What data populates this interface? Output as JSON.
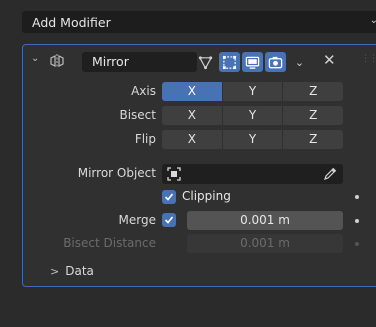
{
  "add_modifier": {
    "label": "Add Modifier",
    "chevron": "chevron-down-icon"
  },
  "modifier": {
    "name": "Mirror",
    "icons": {
      "collapse": "chevron-down-icon",
      "modifier_type": "mirror-modifier-icon",
      "on_cage": "on-cage-icon",
      "edit_mode": "edit-mode-icon",
      "viewport": "viewport-display-icon",
      "render": "render-camera-icon",
      "dropdown": "chevron-down-icon",
      "delete": "close-icon",
      "drag": "drag-handle-icon"
    },
    "axis": {
      "label": "Axis",
      "options": [
        "X",
        "Y",
        "Z"
      ],
      "active": [
        "X"
      ]
    },
    "bisect": {
      "label": "Bisect",
      "options": [
        "X",
        "Y",
        "Z"
      ],
      "active": []
    },
    "flip": {
      "label": "Flip",
      "options": [
        "X",
        "Y",
        "Z"
      ],
      "active": []
    },
    "mirror_object": {
      "label": "Mirror Object",
      "value": ""
    },
    "clipping": {
      "label": "Clipping",
      "checked": true
    },
    "merge": {
      "label": "Merge",
      "checked": true,
      "value": "0.001 m"
    },
    "bisect_distance": {
      "label": "Bisect Distance",
      "value": "0.001 m",
      "enabled": false
    },
    "data_subpanel": {
      "label": "Data",
      "expanded": false
    }
  },
  "colors": {
    "accent": "#4772b3",
    "panel_border": "#3d6db0",
    "background": "#2b2b2b"
  }
}
